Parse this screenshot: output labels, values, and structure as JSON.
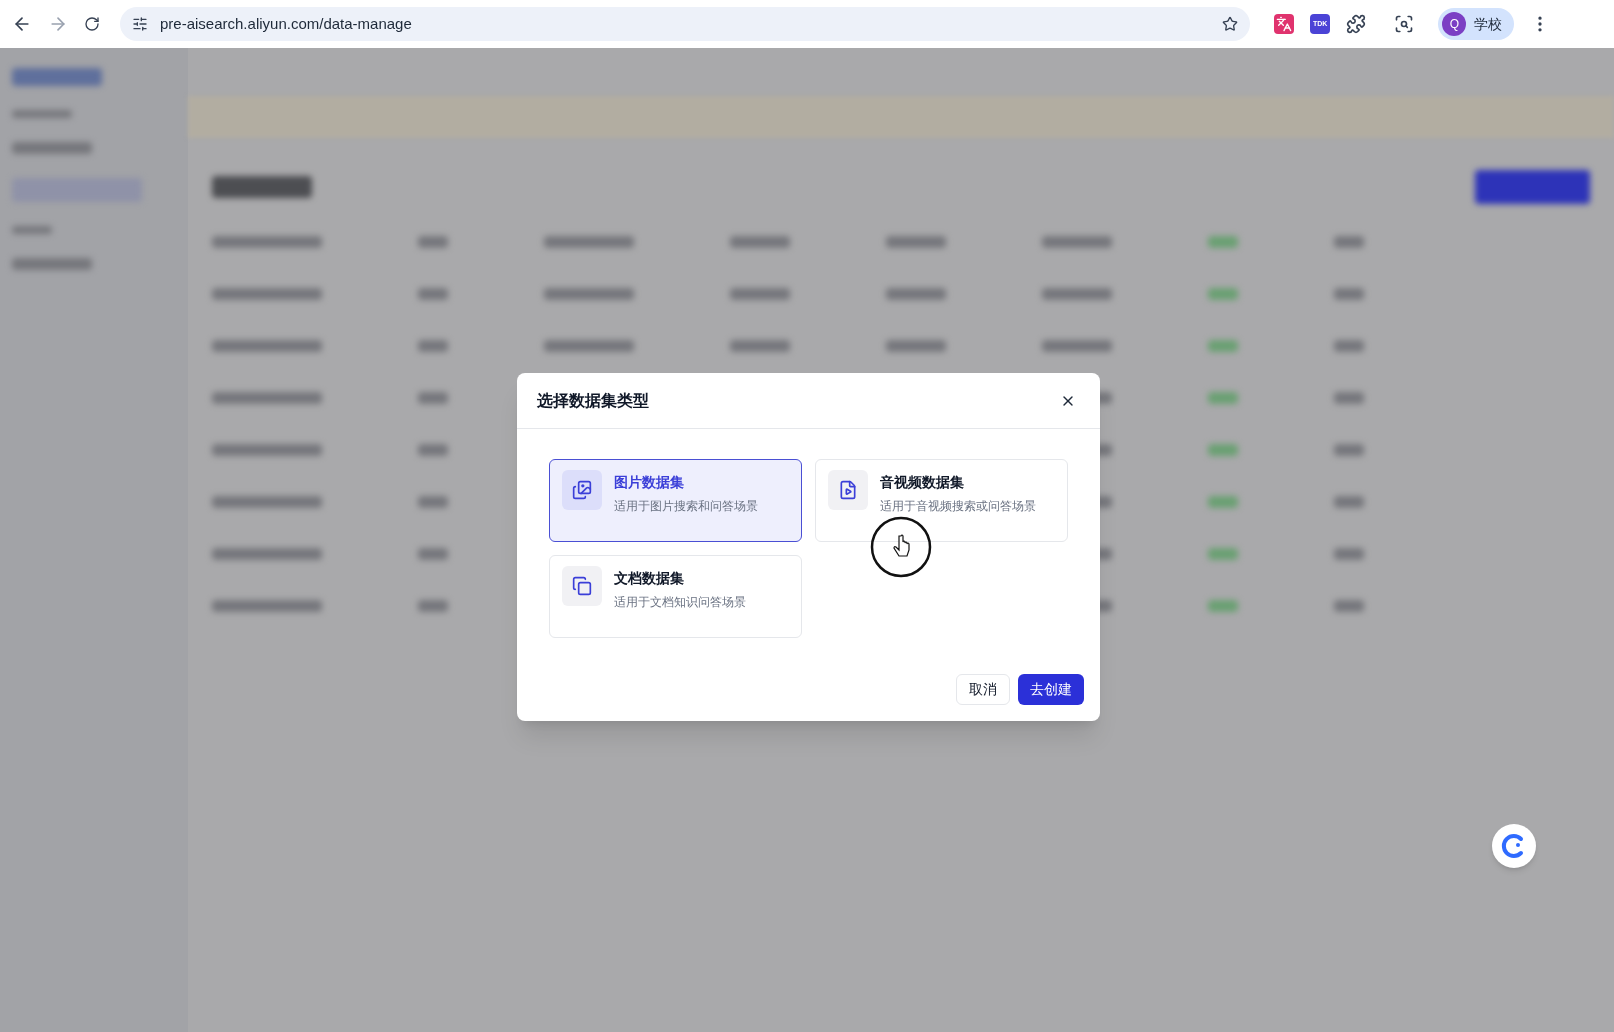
{
  "browser": {
    "url": "pre-aisearch.aliyun.com/data-manage",
    "extension_label": "TDK",
    "profile_initial": "Q",
    "profile_name": "学校"
  },
  "dialog": {
    "title": "选择数据集类型",
    "options": [
      {
        "kind": "image",
        "title": "图片数据集",
        "description": "适用于图片搜索和问答场景",
        "selected": true
      },
      {
        "kind": "video",
        "title": "音视频数据集",
        "description": "适用于音视频搜索或问答场景",
        "selected": false
      },
      {
        "kind": "document",
        "title": "文档数据集",
        "description": "适用于文档知识问答场景",
        "selected": false
      }
    ],
    "buttons": [
      {
        "kind": "secondary",
        "label": "取消"
      },
      {
        "kind": "primary",
        "label": "去创建"
      }
    ]
  }
}
